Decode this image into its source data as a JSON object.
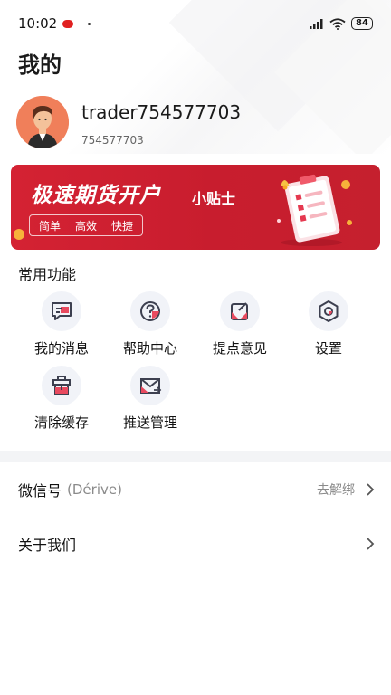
{
  "status_bar": {
    "time": "10:02",
    "battery": "84"
  },
  "page": {
    "title": "我的"
  },
  "profile": {
    "username": "trader754577703",
    "user_id": "754577703"
  },
  "banner": {
    "title": "极速期货开户",
    "subtitle": "小贴士",
    "tags": [
      "简单",
      "高效",
      "快捷"
    ]
  },
  "functions": {
    "section_title": "常用功能",
    "items": [
      {
        "label": "我的消息",
        "icon": "message-icon"
      },
      {
        "label": "帮助中心",
        "icon": "help-icon"
      },
      {
        "label": "提点意见",
        "icon": "feedback-icon"
      },
      {
        "label": "设置",
        "icon": "settings-icon"
      },
      {
        "label": "清除缓存",
        "icon": "clear-cache-icon"
      },
      {
        "label": "推送管理",
        "icon": "push-mail-icon"
      }
    ]
  },
  "settings_list": {
    "wechat": {
      "label": "微信号",
      "account": "(Dérive)",
      "action": "去解绑"
    },
    "about": {
      "label": "关于我们"
    }
  },
  "colors": {
    "accent": "#d42233",
    "icon_bg": "#f1f3f8"
  }
}
